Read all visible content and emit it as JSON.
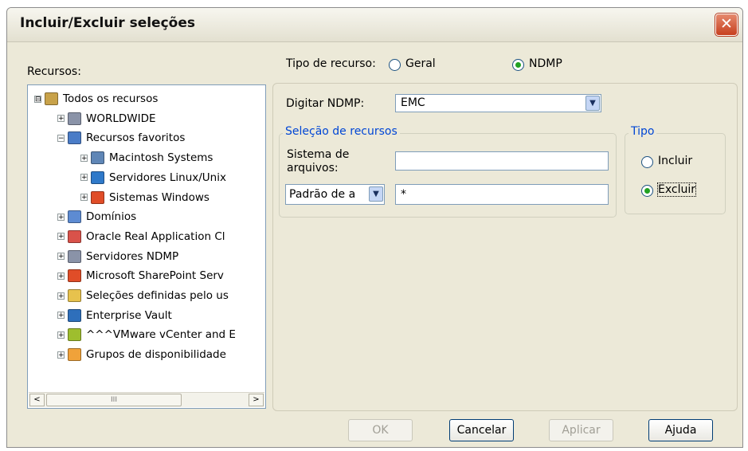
{
  "window": {
    "title": "Incluir/Excluir seleções",
    "close_icon": "close-icon"
  },
  "resources": {
    "label": "Recursos:",
    "tree": [
      {
        "label": "Todos os recursos",
        "expander": "⊟",
        "icon": "all-resources-icon",
        "color": "#c8a24a",
        "level": 0
      },
      {
        "label": "WORLDWIDE",
        "expander": "+",
        "icon": "network-icon",
        "color": "#8a93a8",
        "level": 1
      },
      {
        "label": "Recursos favoritos",
        "expander": "−",
        "icon": "favorites-icon",
        "color": "#4a7cc7",
        "level": 1
      },
      {
        "label": "Macintosh Systems",
        "expander": "+",
        "icon": "mac-icon",
        "color": "#5f86b6",
        "level": 2
      },
      {
        "label": "Servidores Linux/Unix",
        "expander": "+",
        "icon": "linux-server-icon",
        "color": "#2f79c9",
        "level": 2
      },
      {
        "label": "Sistemas Windows",
        "expander": "+",
        "icon": "windows-icon",
        "color": "#e04d28",
        "level": 2
      },
      {
        "label": "Domínios",
        "expander": "+",
        "icon": "domain-icon",
        "color": "#5d8bd2",
        "level": 1
      },
      {
        "label": "Oracle Real Application Cl",
        "expander": "+",
        "icon": "oracle-icon",
        "color": "#d9524a",
        "level": 1
      },
      {
        "label": "Servidores NDMP",
        "expander": "+",
        "icon": "ndmp-server-icon",
        "color": "#8a93a8",
        "level": 1
      },
      {
        "label": "Microsoft SharePoint Serv",
        "expander": "+",
        "icon": "sharepoint-icon",
        "color": "#e04d28",
        "level": 1
      },
      {
        "label": "Seleções definidas pelo us",
        "expander": "+",
        "icon": "folder-icon",
        "color": "#e7c24d",
        "level": 1
      },
      {
        "label": "Enterprise Vault",
        "expander": "+",
        "icon": "vault-icon",
        "color": "#2e6fbb",
        "level": 1
      },
      {
        "label": "^^^VMware vCenter and E",
        "expander": "+",
        "icon": "vmware-icon",
        "color": "#9ebe2e",
        "level": 1
      },
      {
        "label": "Grupos de disponibilidade",
        "expander": "+",
        "icon": "availability-group-icon",
        "color": "#f0a23a",
        "level": 1
      }
    ],
    "scroll": {
      "left": "<",
      "right": ">",
      "thumb": "III"
    }
  },
  "resource_type": {
    "label": "Tipo de recurso:",
    "options": [
      {
        "label": "Geral",
        "selected": false
      },
      {
        "label": "NDMP",
        "selected": true
      }
    ]
  },
  "ndmp": {
    "label": "Digitar NDMP:",
    "value": "EMC"
  },
  "selection": {
    "legend": "Seleção de recursos",
    "fs_label_line1": "Sistema de",
    "fs_label_line2": "arquivos:",
    "fs_value": "",
    "pattern_select": "Padrão de a",
    "pattern_value": "*"
  },
  "type_group": {
    "legend": "Tipo",
    "options": [
      {
        "label": "Incluir",
        "selected": false
      },
      {
        "label": "Excluir",
        "selected": true
      }
    ]
  },
  "buttons": {
    "ok": "OK",
    "cancel": "Cancelar",
    "apply": "Aplicar",
    "help": "Ajuda"
  },
  "colors": {
    "accent_blue": "#0046d5",
    "radio_selected": "#21a121",
    "close_red": "#c7401f"
  }
}
